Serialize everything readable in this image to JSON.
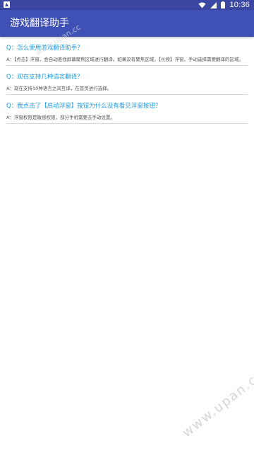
{
  "status_bar": {
    "time": "10:36",
    "icons": [
      "notification-icon",
      "wifi-icon",
      "signal-icon",
      "battery-icon"
    ]
  },
  "app_bar": {
    "title": "游戏翻译助手"
  },
  "faq": [
    {
      "question": "Q：怎么使用游戏翻译助手？",
      "answer": "A：【点击】浮窗，会自动查找屏幕聚焦区域进行翻译。如果没有聚焦区域，【长按】浮窗，手动选择需要翻译的区域。"
    },
    {
      "question": "Q：现在支持几种语言翻译？",
      "answer": "A：现在支持10种语言之间互译，在首页进行选择。"
    },
    {
      "question": "Q：我点击了【启动浮窗】按钮为什么没有看见浮窗按钮？",
      "answer": "A：浮窗权限是敏感权限，部分手机需要去手动设置。"
    }
  ],
  "watermarks": {
    "top": "www.upan.cc",
    "bottom": "www.upan.cc"
  },
  "colors": {
    "app_bar": "#3f51b5",
    "status_bar": "#3a47a3",
    "question_text": "#1e9be0",
    "answer_text": "#555555",
    "divider": "#d9d9d9"
  }
}
